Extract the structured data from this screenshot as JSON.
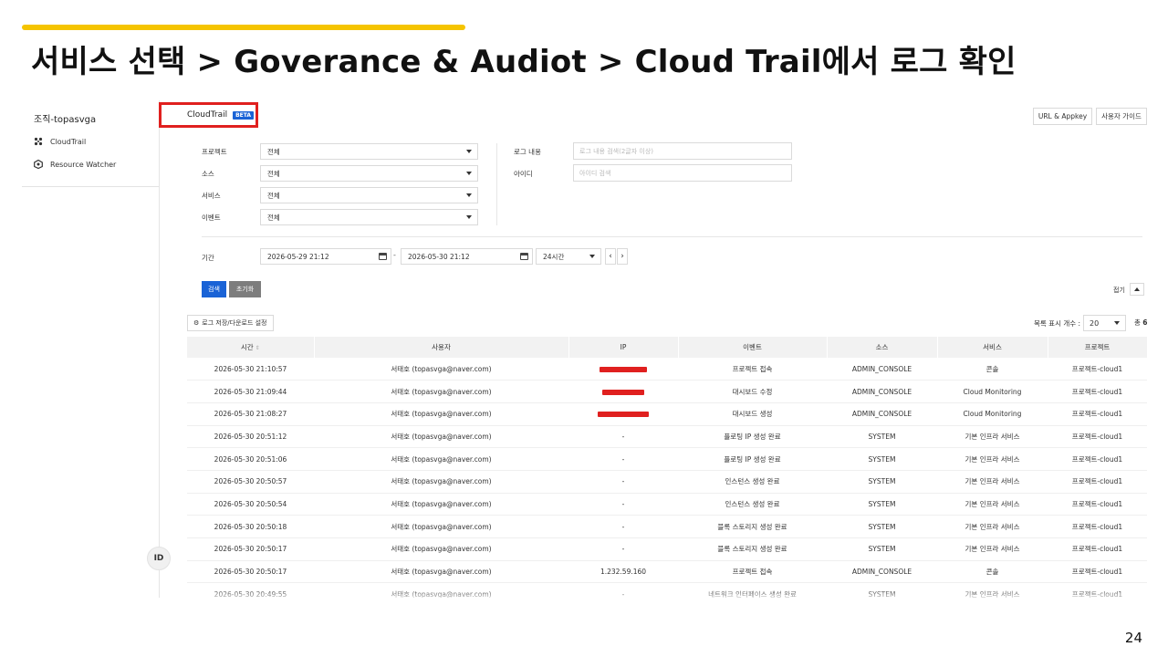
{
  "slide": {
    "title": "서비스 선택 > Goverance & Audiot > Cloud Trail에서 로그 확인",
    "page_number": "24",
    "accent_color": "#f5c400"
  },
  "sidebar": {
    "org_name": "조직-topasvga",
    "items": [
      {
        "label": "CloudTrail",
        "icon": "cloudtrail-icon"
      },
      {
        "label": "Resource Watcher",
        "icon": "resource-watcher-icon"
      }
    ],
    "collapse_label": "ID"
  },
  "header": {
    "product": "CloudTrail",
    "badge": "BETA",
    "url_appkey": "URL & Appkey",
    "user_guide": "사용자 가이드",
    "highlight_color": "#e0201f"
  },
  "filters": {
    "project": {
      "label": "프로젝트",
      "value": "전체"
    },
    "source": {
      "label": "소스",
      "value": "전체"
    },
    "service": {
      "label": "서비스",
      "value": "전체"
    },
    "event": {
      "label": "이벤트",
      "value": "전체"
    },
    "log_content": {
      "label": "로그 내용",
      "placeholder": "로그 내용 검색(2글자 이상)"
    },
    "user_id": {
      "label": "아이디",
      "placeholder": "아이디 검색"
    },
    "period": {
      "label": "기간",
      "start": "2026-05-29 21:12",
      "end": "2026-05-30 21:12",
      "separator": "-",
      "range": "24시간",
      "prev": "‹",
      "next": "›"
    },
    "search_button": "검색",
    "reset_button": "초기화",
    "fold_label": "접기"
  },
  "list_controls": {
    "settings_button": "로그 저장/다운로드 설정",
    "page_size_label": "목록 표시 개수 :",
    "page_size": "20",
    "total_label": "총",
    "total_count": "6"
  },
  "table": {
    "columns": [
      "시간",
      "사용자",
      "IP",
      "이벤트",
      "소스",
      "서비스",
      "프로젝트"
    ],
    "sort_icon": "⇕",
    "rows": [
      {
        "time": "2026-05-30 21:10:57",
        "user": "서태호 (topasvga@naver.com)",
        "ip": "",
        "ip_redacted": true,
        "event": "프로젝트 접속",
        "source": "ADMIN_CONSOLE",
        "service": "콘솔",
        "project": "프로젝트-cloud1"
      },
      {
        "time": "2026-05-30 21:09:44",
        "user": "서태호 (topasvga@naver.com)",
        "ip": "",
        "ip_redacted": true,
        "event": "대시보드 수정",
        "source": "ADMIN_CONSOLE",
        "service": "Cloud Monitoring",
        "project": "프로젝트-cloud1"
      },
      {
        "time": "2026-05-30 21:08:27",
        "user": "서태호 (topasvga@naver.com)",
        "ip": "",
        "ip_redacted": true,
        "event": "대시보드 생성",
        "source": "ADMIN_CONSOLE",
        "service": "Cloud Monitoring",
        "project": "프로젝트-cloud1"
      },
      {
        "time": "2026-05-30 20:51:12",
        "user": "서태호 (topasvga@naver.com)",
        "ip": "-",
        "ip_redacted": false,
        "event": "플로팅 IP 생성 완료",
        "source": "SYSTEM",
        "service": "기본 인프라 서비스",
        "project": "프로젝트-cloud1"
      },
      {
        "time": "2026-05-30 20:51:06",
        "user": "서태호 (topasvga@naver.com)",
        "ip": "-",
        "ip_redacted": false,
        "event": "플로팅 IP 생성 완료",
        "source": "SYSTEM",
        "service": "기본 인프라 서비스",
        "project": "프로젝트-cloud1"
      },
      {
        "time": "2026-05-30 20:50:57",
        "user": "서태호 (topasvga@naver.com)",
        "ip": "-",
        "ip_redacted": false,
        "event": "인스턴스 생성 완료",
        "source": "SYSTEM",
        "service": "기본 인프라 서비스",
        "project": "프로젝트-cloud1"
      },
      {
        "time": "2026-05-30 20:50:54",
        "user": "서태호 (topasvga@naver.com)",
        "ip": "-",
        "ip_redacted": false,
        "event": "인스턴스 생성 완료",
        "source": "SYSTEM",
        "service": "기본 인프라 서비스",
        "project": "프로젝트-cloud1"
      },
      {
        "time": "2026-05-30 20:50:18",
        "user": "서태호 (topasvga@naver.com)",
        "ip": "-",
        "ip_redacted": false,
        "event": "블록 스토리지 생성 완료",
        "source": "SYSTEM",
        "service": "기본 인프라 서비스",
        "project": "프로젝트-cloud1"
      },
      {
        "time": "2026-05-30 20:50:17",
        "user": "서태호 (topasvga@naver.com)",
        "ip": "-",
        "ip_redacted": false,
        "event": "블록 스토리지 생성 완료",
        "source": "SYSTEM",
        "service": "기본 인프라 서비스",
        "project": "프로젝트-cloud1"
      },
      {
        "time": "2026-05-30 20:50:17",
        "user": "서태호 (topasvga@naver.com)",
        "ip": "1.232.59.160",
        "ip_redacted": false,
        "event": "프로젝트 접속",
        "source": "ADMIN_CONSOLE",
        "service": "콘솔",
        "project": "프로젝트-cloud1"
      },
      {
        "time": "2026-05-30 20:49:55",
        "user": "서태호 (topasvga@naver.com)",
        "ip": "-",
        "ip_redacted": false,
        "event": "네트워크 인터페이스 생성 완료",
        "source": "SYSTEM",
        "service": "기본 인프라 서비스",
        "project": "프로젝트-cloud1"
      }
    ]
  }
}
